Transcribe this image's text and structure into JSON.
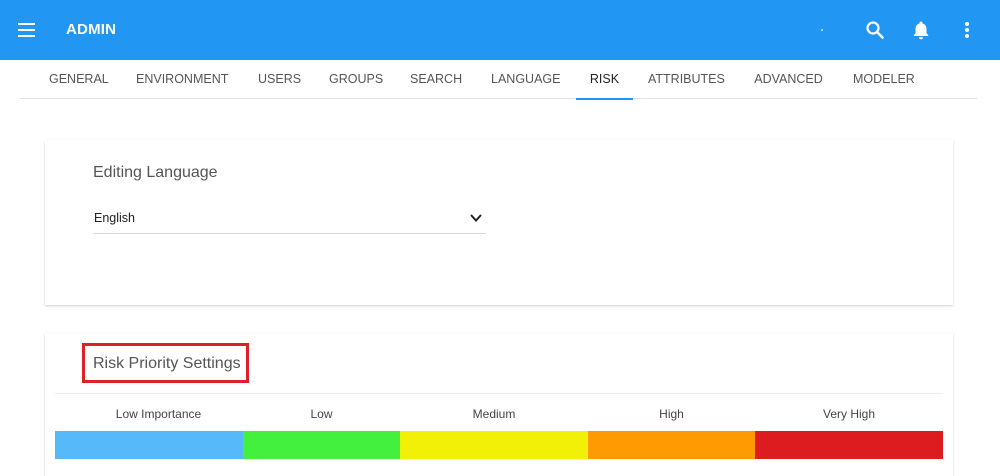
{
  "header": {
    "title": "ADMIN",
    "bg_color": "#2196f3",
    "icons": [
      "menu-icon",
      "search-icon",
      "bell-icon",
      "more-vert-icon"
    ]
  },
  "tabs": [
    {
      "label": "GENERAL"
    },
    {
      "label": "ENVIRONMENT"
    },
    {
      "label": "USERS"
    },
    {
      "label": "GROUPS"
    },
    {
      "label": "SEARCH"
    },
    {
      "label": "LANGUAGE"
    },
    {
      "label": "RISK",
      "active": true
    },
    {
      "label": "ATTRIBUTES"
    },
    {
      "label": "ADVANCED"
    },
    {
      "label": "MODELER"
    }
  ],
  "editing_language": {
    "title": "Editing Language",
    "selected": "English"
  },
  "risk_priority": {
    "title": "Risk Priority Settings",
    "levels": [
      {
        "label": "Low Importance",
        "color": "#56b9f9"
      },
      {
        "label": "Low",
        "color": "#42f03d"
      },
      {
        "label": "Medium",
        "color": "#f2f007"
      },
      {
        "label": "High",
        "color": "#ff9a02"
      },
      {
        "label": "Very High",
        "color": "#dc1c1f"
      }
    ]
  }
}
